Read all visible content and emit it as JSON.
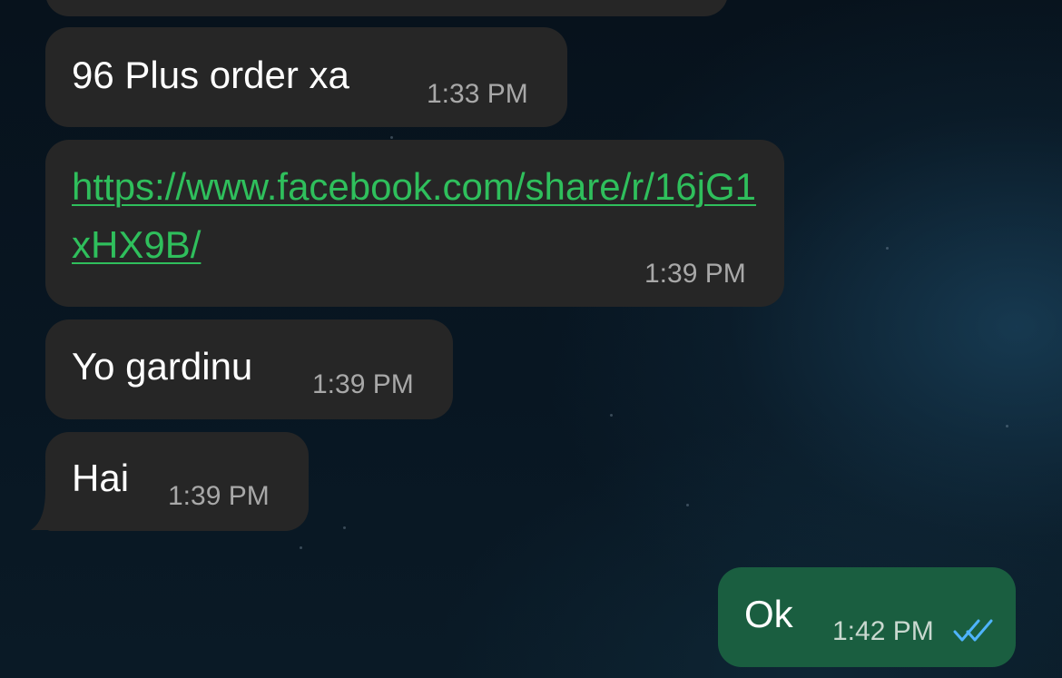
{
  "messages": [
    {
      "direction": "incoming",
      "text": "96 Plus order xa",
      "time": "1:33 PM"
    },
    {
      "direction": "incoming",
      "text": "https://www.facebook.com/share/r/16jG1xHX9B/",
      "time": "1:39 PM",
      "is_link": true
    },
    {
      "direction": "incoming",
      "text": "Yo gardinu",
      "time": "1:39 PM"
    },
    {
      "direction": "incoming",
      "text": "Hai",
      "time": "1:39 PM"
    },
    {
      "direction": "outgoing",
      "text": "Ok",
      "time": "1:42 PM",
      "status": "read"
    }
  ],
  "colors": {
    "incoming_bubble": "#262626",
    "outgoing_bubble": "#1a5e40",
    "link": "#2fbf5c",
    "read_receipt": "#4fb4ff",
    "timestamp": "#a8a8a8"
  },
  "icons": {
    "read_receipt": "double-check-icon"
  }
}
